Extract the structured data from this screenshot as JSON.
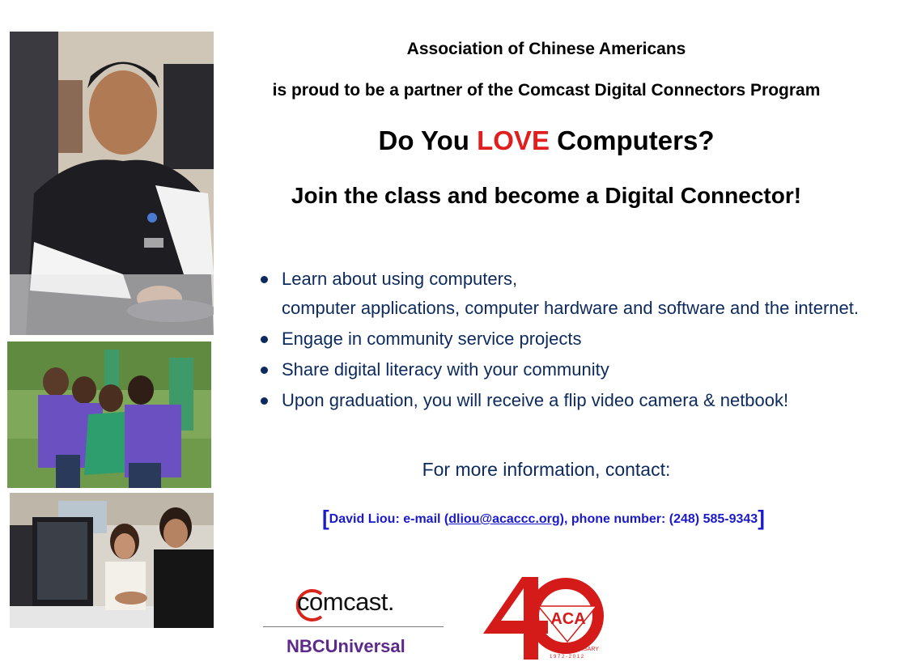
{
  "header": {
    "org_name": "Association of Chinese Americans",
    "partner_line": "is proud to be a partner of the Comcast Digital Connectors Program"
  },
  "headline": {
    "prefix": "Do You ",
    "emphasis": "LOVE",
    "suffix": " Computers?",
    "emphasis_color": "#e01e1e"
  },
  "subhead": "Join the class and become a Digital Connector!",
  "bullets": {
    "item1_line1": "Learn about using computers,",
    "item1_line2": "computer applications, computer hardware and software and the internet.",
    "item2": "Engage in community service projects",
    "item3": "Share digital literacy with your community",
    "item4": "Upon graduation, you will receive a flip video camera & netbook!"
  },
  "contact": {
    "heading": "For more information, contact:",
    "open_bracket": "[",
    "name_prefix": "David Liou: e-mail (",
    "email": "dliou@acaccc.org",
    "phone_part": "), phone number: (248) 585-9343",
    "close_bracket": "]"
  },
  "logos": {
    "comcast": "comcast.",
    "nbc": "NBCUniversal",
    "aca_letters": "ACA",
    "aca_numeral": "4",
    "aca_anniversary": "TH ANNIVERSARY",
    "aca_years": "1 9 7 2 - 2 0 1 2"
  },
  "colors": {
    "text_blue": "#0c2a5e",
    "link_blue": "#1a1acc",
    "red": "#e01e1e",
    "nbc_purple": "#5b2a8a"
  }
}
